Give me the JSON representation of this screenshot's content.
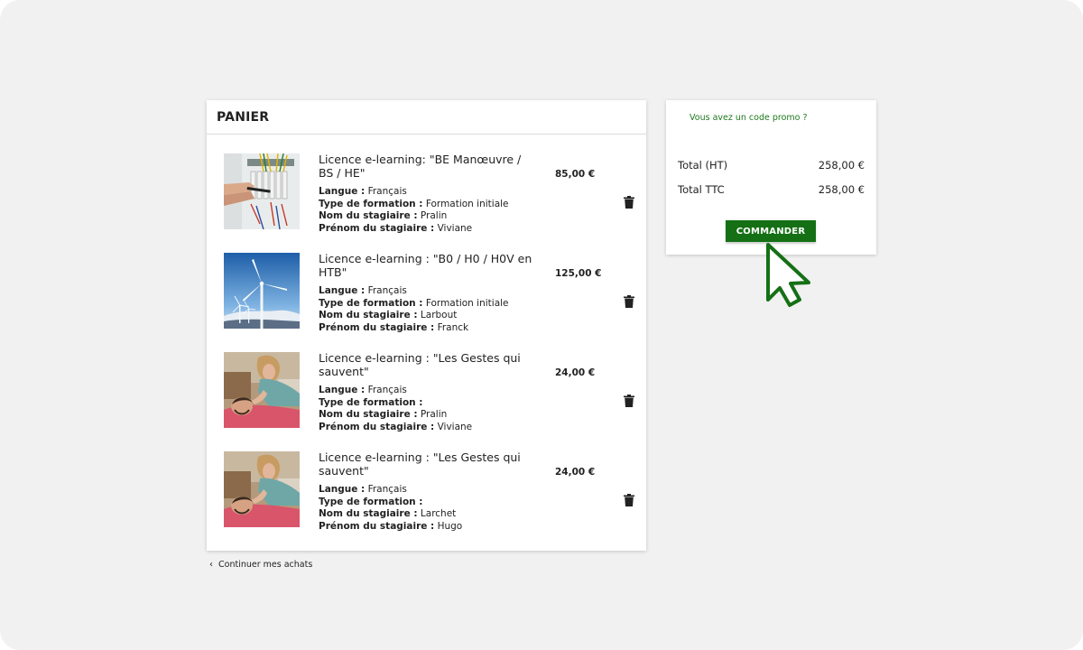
{
  "cart": {
    "title": "PANIER",
    "items": [
      {
        "title": "Licence e-learning: \"BE Manœuvre / BS / HE\"",
        "price": "85,00 €",
        "langue_label": "Langue :",
        "langue": "Français",
        "type_label": "Type de formation :",
        "type": "Formation initiale",
        "nom_label": "Nom du stagiaire :",
        "nom": "Pralin",
        "prenom_label": "Prénom du stagiaire :",
        "prenom": "Viviane",
        "image": "electrical-panel-photo"
      },
      {
        "title": "Licence e-learning : \"B0 / H0 / H0V en HTB\"",
        "price": "125,00 €",
        "langue_label": "Langue :",
        "langue": "Français",
        "type_label": "Type de formation :",
        "type": "Formation initiale",
        "nom_label": "Nom du stagiaire :",
        "nom": "Larbout",
        "prenom_label": "Prénom du stagiaire :",
        "prenom": "Franck",
        "image": "wind-turbine-photo"
      },
      {
        "title": "Licence e-learning : \"Les Gestes qui sauvent\"",
        "price": "24,00 €",
        "langue_label": "Langue :",
        "langue": "Français",
        "type_label": "Type de formation :",
        "type": "",
        "nom_label": "Nom du stagiaire :",
        "nom": "Pralin",
        "prenom_label": "Prénom du stagiaire :",
        "prenom": "Viviane",
        "image": "first-aid-photo"
      },
      {
        "title": "Licence e-learning : \"Les Gestes qui sauvent\"",
        "price": "24,00 €",
        "langue_label": "Langue :",
        "langue": "Français",
        "type_label": "Type de formation :",
        "type": "",
        "nom_label": "Nom du stagiaire :",
        "nom": "Larchet",
        "prenom_label": "Prénom du stagiaire :",
        "prenom": "Hugo",
        "image": "first-aid-photo"
      }
    ],
    "continue_label": "Continuer mes achats",
    "delete_icon": "trash-icon"
  },
  "summary": {
    "promo_label": "Vous avez un code promo ?",
    "total_ht_label": "Total (HT)",
    "total_ht": "258,00 €",
    "total_ttc_label": "Total TTC",
    "total_ttc": "258,00 €",
    "order_button": "COMMANDER"
  },
  "colors": {
    "accent": "#157015",
    "promo_link": "#1e7a1e",
    "background": "#f1f1f1",
    "cursor_outline": "#157015"
  }
}
